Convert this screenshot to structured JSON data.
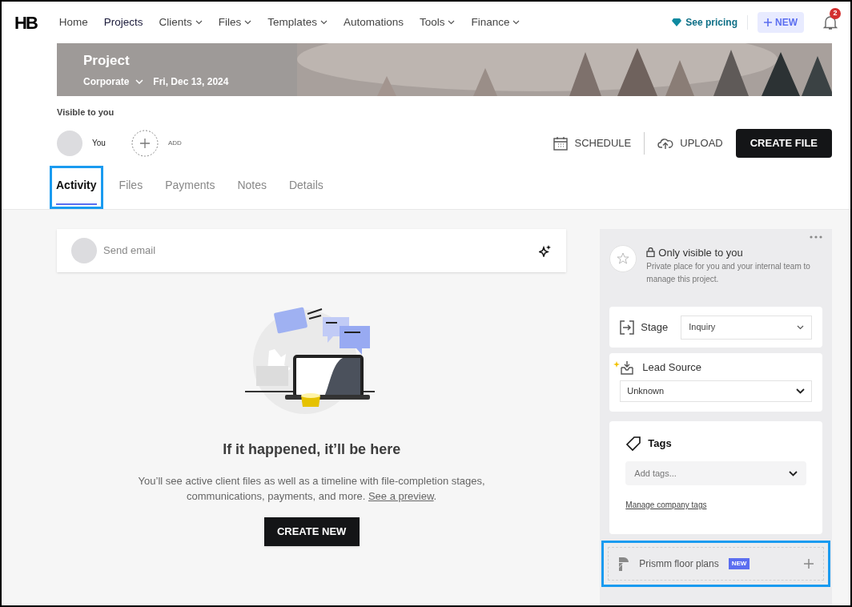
{
  "nav": {
    "logo": "HB",
    "items": [
      {
        "label": "Home",
        "selected": false,
        "dropdown": false
      },
      {
        "label": "Projects",
        "selected": true,
        "dropdown": false
      },
      {
        "label": "Clients",
        "selected": false,
        "dropdown": true
      },
      {
        "label": "Files",
        "selected": false,
        "dropdown": true
      },
      {
        "label": "Templates",
        "selected": false,
        "dropdown": true
      },
      {
        "label": "Automations",
        "selected": false,
        "dropdown": false
      },
      {
        "label": "Tools",
        "selected": false,
        "dropdown": true
      },
      {
        "label": "Finance",
        "selected": false,
        "dropdown": true
      }
    ],
    "pricing": "See pricing",
    "new_button": "NEW",
    "notifications": "2"
  },
  "header": {
    "title": "Project",
    "type": "Corporate",
    "date": "Fri, Dec 13, 2024"
  },
  "visibility": "Visible to you",
  "members": [
    {
      "label": "You",
      "kind": "avatar"
    },
    {
      "label": "ADD",
      "kind": "add"
    }
  ],
  "actions": {
    "schedule": "SCHEDULE",
    "upload": "UPLOAD",
    "create": "CREATE FILE"
  },
  "tabs": [
    {
      "label": "Activity",
      "selected": true,
      "highlighted": true
    },
    {
      "label": "Files",
      "selected": false,
      "highlighted": false
    },
    {
      "label": "Payments",
      "selected": false,
      "highlighted": false
    },
    {
      "label": "Notes",
      "selected": false,
      "highlighted": false
    },
    {
      "label": "Details",
      "selected": false,
      "highlighted": false
    }
  ],
  "composer": {
    "placeholder": "Send email"
  },
  "empty_state": {
    "title": "If it happened, it’ll be here",
    "text": "You’ll see active client files as well as a timeline with file-completion stages, communications, payments, and more.",
    "link": "See a preview",
    "after_link": ".",
    "button": "CREATE NEW"
  },
  "sidebar": {
    "private": {
      "title": "Only visible to you",
      "text": "Private place for you and your internal team to manage this project."
    },
    "stage": {
      "label": "Stage",
      "value": "Inquiry"
    },
    "lead_source": {
      "label": "Lead Source",
      "value": "Unknown"
    },
    "tags": {
      "label": "Tags",
      "placeholder": "Add tags...",
      "link": "Manage company tags"
    },
    "integration": {
      "label": "Prismm floor plans",
      "badge": "NEW",
      "highlighted": true
    }
  }
}
